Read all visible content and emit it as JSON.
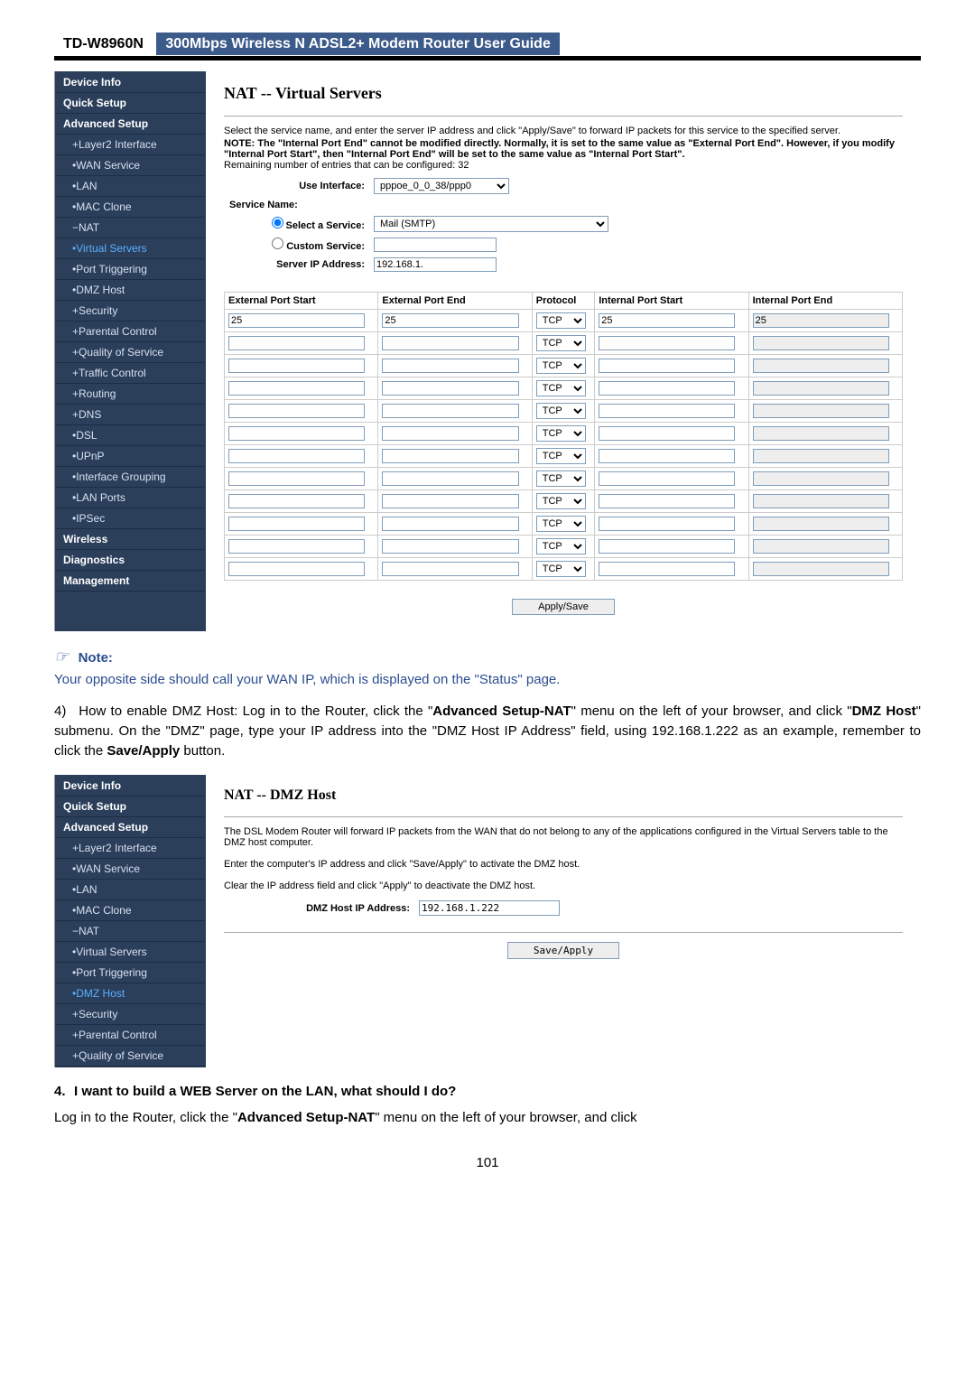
{
  "header": {
    "model": "TD-W8960N",
    "title": "300Mbps Wireless N ADSL2+ Modem Router User Guide"
  },
  "sidebar1": {
    "items": [
      {
        "label": "Device Info",
        "cls": "header-item"
      },
      {
        "label": "Quick Setup",
        "cls": "header-item"
      },
      {
        "label": "Advanced Setup",
        "cls": "header-item"
      },
      {
        "label": "+Layer2 Interface",
        "cls": "sub"
      },
      {
        "label": "•WAN Service",
        "cls": "sub"
      },
      {
        "label": "•LAN",
        "cls": "sub"
      },
      {
        "label": "•MAC Clone",
        "cls": "sub"
      },
      {
        "label": "−NAT",
        "cls": "sub"
      },
      {
        "label": "•Virtual Servers",
        "cls": "sub active"
      },
      {
        "label": "•Port Triggering",
        "cls": "sub"
      },
      {
        "label": "•DMZ Host",
        "cls": "sub"
      },
      {
        "label": "+Security",
        "cls": "sub"
      },
      {
        "label": "+Parental Control",
        "cls": "sub"
      },
      {
        "label": "+Quality of Service",
        "cls": "sub"
      },
      {
        "label": "+Traffic Control",
        "cls": "sub"
      },
      {
        "label": "+Routing",
        "cls": "sub"
      },
      {
        "label": "+DNS",
        "cls": "sub"
      },
      {
        "label": "•DSL",
        "cls": "sub"
      },
      {
        "label": "•UPnP",
        "cls": "sub"
      },
      {
        "label": "•Interface Grouping",
        "cls": "sub"
      },
      {
        "label": "•LAN Ports",
        "cls": "sub"
      },
      {
        "label": "•IPSec",
        "cls": "sub"
      },
      {
        "label": "Wireless",
        "cls": "header-item"
      },
      {
        "label": "Diagnostics",
        "cls": "header-item"
      },
      {
        "label": "Management",
        "cls": "header-item"
      }
    ]
  },
  "vs": {
    "title": "NAT -- Virtual Servers",
    "desc": "Select the service name, and enter the server IP address and click \"Apply/Save\" to forward IP packets for this service to the specified server.",
    "note": "NOTE: The \"Internal Port End\" cannot be modified directly. Normally, it is set to the same value as \"External Port End\". However, if you modify \"Internal Port Start\", then \"Internal Port End\" will be set to the same value as \"Internal Port Start\".",
    "remaining": "Remaining number of entries that can be configured: 32",
    "use_iface_label": "Use Interface:",
    "use_iface_value": "pppoe_0_0_38/ppp0",
    "service_name_label": "Service Name:",
    "select_service_label": "Select a Service:",
    "select_service_value": "Mail (SMTP)",
    "custom_service_label": "Custom Service:",
    "custom_service_value": "",
    "server_ip_label": "Server IP Address:",
    "server_ip_value": "192.168.1.",
    "headers": [
      "External Port Start",
      "External Port End",
      "Protocol",
      "Internal Port Start",
      "Internal Port End"
    ],
    "rows": [
      {
        "eps": "25",
        "epe": "25",
        "proto": "TCP",
        "ips": "25",
        "ipe": "25"
      },
      {
        "eps": "",
        "epe": "",
        "proto": "TCP",
        "ips": "",
        "ipe": ""
      },
      {
        "eps": "",
        "epe": "",
        "proto": "TCP",
        "ips": "",
        "ipe": ""
      },
      {
        "eps": "",
        "epe": "",
        "proto": "TCP",
        "ips": "",
        "ipe": ""
      },
      {
        "eps": "",
        "epe": "",
        "proto": "TCP",
        "ips": "",
        "ipe": ""
      },
      {
        "eps": "",
        "epe": "",
        "proto": "TCP",
        "ips": "",
        "ipe": ""
      },
      {
        "eps": "",
        "epe": "",
        "proto": "TCP",
        "ips": "",
        "ipe": ""
      },
      {
        "eps": "",
        "epe": "",
        "proto": "TCP",
        "ips": "",
        "ipe": ""
      },
      {
        "eps": "",
        "epe": "",
        "proto": "TCP",
        "ips": "",
        "ipe": ""
      },
      {
        "eps": "",
        "epe": "",
        "proto": "TCP",
        "ips": "",
        "ipe": ""
      },
      {
        "eps": "",
        "epe": "",
        "proto": "TCP",
        "ips": "",
        "ipe": ""
      },
      {
        "eps": "",
        "epe": "",
        "proto": "TCP",
        "ips": "",
        "ipe": ""
      }
    ],
    "apply": "Apply/Save"
  },
  "note_section": {
    "hand": "☞",
    "label": "Note:",
    "text": "Your opposite side should call your WAN IP, which is displayed on the \"Status\" page."
  },
  "step4": {
    "num": "4)",
    "pre": "How to enable DMZ Host: Log in to the Router, click the \"",
    "bold1": "Advanced Setup-NAT",
    "mid1": "\" menu on the left of your browser, and click \"",
    "bold2": "DMZ Host",
    "mid2": "\" submenu. On the \"DMZ\" page, type your IP address into the \"DMZ Host IP Address\" field, using 192.168.1.222 as an example, remember to click the ",
    "bold3": "Save/Apply",
    "post": " button."
  },
  "sidebar2": {
    "items": [
      {
        "label": "Device Info",
        "cls": "header-item"
      },
      {
        "label": "Quick Setup",
        "cls": "header-item"
      },
      {
        "label": "Advanced Setup",
        "cls": "header-item"
      },
      {
        "label": "+Layer2 Interface",
        "cls": "sub"
      },
      {
        "label": "•WAN Service",
        "cls": "sub"
      },
      {
        "label": "•LAN",
        "cls": "sub"
      },
      {
        "label": "•MAC Clone",
        "cls": "sub"
      },
      {
        "label": "−NAT",
        "cls": "sub"
      },
      {
        "label": "•Virtual Servers",
        "cls": "sub"
      },
      {
        "label": "•Port Triggering",
        "cls": "sub"
      },
      {
        "label": "•DMZ Host",
        "cls": "sub active"
      },
      {
        "label": "+Security",
        "cls": "sub"
      },
      {
        "label": "+Parental Control",
        "cls": "sub"
      },
      {
        "label": "+Quality of Service",
        "cls": "sub"
      }
    ]
  },
  "dmz": {
    "title": "NAT -- DMZ Host",
    "p1": "The DSL Modem Router will forward IP packets from the WAN that do not belong to any of the applications configured in the Virtual Servers table to the DMZ host computer.",
    "p2": "Enter the computer's IP address and click \"Save/Apply\" to activate the DMZ host.",
    "p3": "Clear the IP address field and click \"Apply\" to deactivate the DMZ host.",
    "ip_label": "DMZ Host IP Address:",
    "ip_value": "192.168.1.222",
    "save": "Save/Apply"
  },
  "q4": {
    "num": "4.",
    "text": "I want to build a WEB Server on the LAN, what should I do?"
  },
  "footer": {
    "pre": "Log in to the Router, click the \"",
    "bold": "Advanced Setup-NAT",
    "post": "\" menu on the left of your browser, and click"
  },
  "page_num": "101"
}
